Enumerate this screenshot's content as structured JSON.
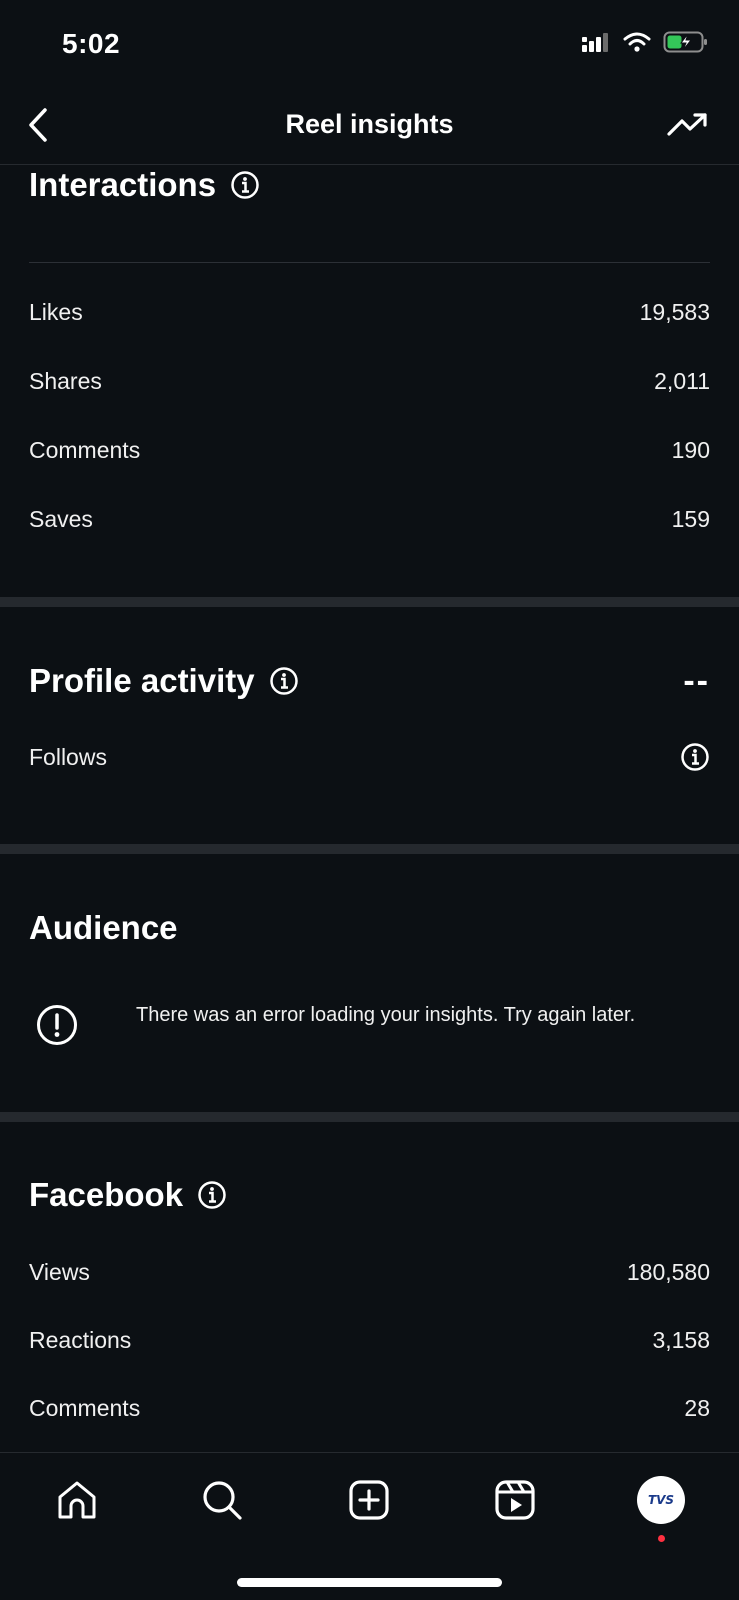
{
  "status_bar": {
    "time": "5:02"
  },
  "header": {
    "title": "Reel insights"
  },
  "interactions": {
    "title": "Interactions",
    "rows": [
      {
        "label": "Likes",
        "value": "19,583"
      },
      {
        "label": "Shares",
        "value": "2,011"
      },
      {
        "label": "Comments",
        "value": "190"
      },
      {
        "label": "Saves",
        "value": "159"
      }
    ]
  },
  "profile_activity": {
    "title": "Profile activity",
    "value": "--",
    "rows": [
      {
        "label": "Follows"
      }
    ]
  },
  "audience": {
    "title": "Audience",
    "error_message": "There was an error loading your insights. Try again later."
  },
  "facebook": {
    "title": "Facebook",
    "rows": [
      {
        "label": "Views",
        "value": "180,580"
      },
      {
        "label": "Reactions",
        "value": "3,158"
      },
      {
        "label": "Comments",
        "value": "28"
      }
    ]
  },
  "tab_bar": {
    "profile_avatar_text": "TVS",
    "tabs": [
      "home-icon",
      "search-icon",
      "create-icon",
      "reels-icon",
      "profile-avatar"
    ]
  },
  "colors": {
    "background": "#0c1014",
    "section_gap": "#25292e",
    "text": "#f5f5f5",
    "battery_green": "#34c759",
    "notification": "#ff3040"
  }
}
